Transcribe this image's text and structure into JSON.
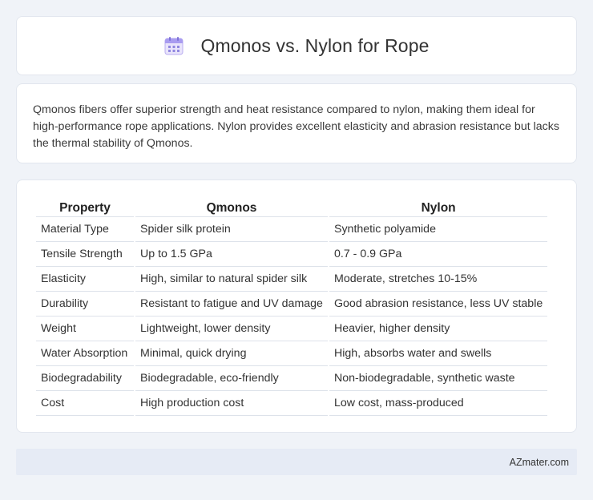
{
  "header": {
    "title": "Qmonos vs. Nylon for Rope",
    "icon": "calendar-icon"
  },
  "summary": {
    "text": "Qmonos fibers offer superior strength and heat resistance compared to nylon, making them ideal for high-performance rope applications. Nylon provides excellent elasticity and abrasion resistance but lacks the thermal stability of Qmonos."
  },
  "table": {
    "headers": [
      "Property",
      "Qmonos",
      "Nylon"
    ],
    "rows": [
      [
        "Material Type",
        "Spider silk protein",
        "Synthetic polyamide"
      ],
      [
        "Tensile Strength",
        "Up to 1.5 GPa",
        "0.7 - 0.9 GPa"
      ],
      [
        "Elasticity",
        "High, similar to natural spider silk",
        "Moderate, stretches 10-15%"
      ],
      [
        "Durability",
        "Resistant to fatigue and UV damage",
        "Good abrasion resistance, less UV stable"
      ],
      [
        "Weight",
        "Lightweight, lower density",
        "Heavier, higher density"
      ],
      [
        "Water Absorption",
        "Minimal, quick drying",
        "High, absorbs water and swells"
      ],
      [
        "Biodegradability",
        "Biodegradable, eco-friendly",
        "Non-biodegradable, synthetic waste"
      ],
      [
        "Cost",
        "High production cost",
        "Low cost, mass-produced"
      ]
    ]
  },
  "footer": {
    "text": "AZmater.com"
  }
}
